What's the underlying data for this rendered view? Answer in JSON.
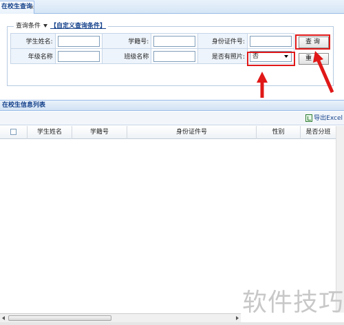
{
  "tab": {
    "title": "在校生查询",
    "close_glyph": "×"
  },
  "query": {
    "legend_label": "查询条件",
    "custom_link": "【自定义查询条件】",
    "fields": {
      "student_name_label": "学生姓名:",
      "student_no_label": "学籍号:",
      "id_no_label": "身份证件号:",
      "grade_label": "年级名称",
      "class_label": "班级名称",
      "photo_label": "是否有照片:",
      "photo_value": "否"
    },
    "search_button": "查询",
    "reset_button": "重置"
  },
  "list": {
    "title": "在校生信息列表",
    "export_label": "导出Excel",
    "columns": [
      "学生姓名",
      "学籍号",
      "身份证件号",
      "性别",
      "是否分班"
    ]
  },
  "watermark": "软件技巧",
  "colors": {
    "highlight": "#e01818",
    "header_blue": "#15428b",
    "border_blue": "#99bbe8"
  },
  "icons": [
    "close-icon",
    "chevron-down-icon",
    "excel-icon",
    "arrow-up-annotation-icon"
  ]
}
